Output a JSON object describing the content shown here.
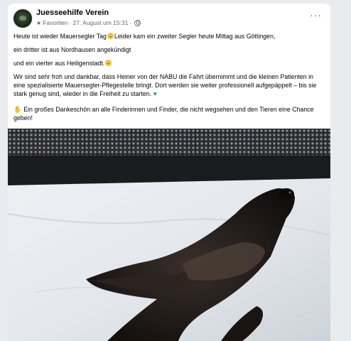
{
  "post": {
    "page_name": "Juesseehilfe Verein",
    "audience": "Favoriten",
    "separator": "·",
    "date": "27. August um 15:31",
    "more_label": "···",
    "paragraphs": [
      "Heute ist wieder Mauersegler Tag",
      "Leider kam ein zweiter Segler heute Mittag aus Göttingen,",
      "ein dritter ist aus Nordhausen angekündigt",
      "und ein vierter aus Heiligenstadt.",
      "Wir sind sehr froh und dankbar, dass Heiner von der  NABU die Fahrt übernimmt und die kleinen Patienten in eine spezialisierte Mauersegler-Pflegestelle bringt. Dort werden sie weiter professionell aufgepäppelt – bis sie stark genug sind, wieder in die Freiheit zu starten.",
      "Ein großes Dankeschön an alle Finderinnen und Finder, die nicht wegsehen und den Tieren eine Chance geben!"
    ],
    "icons": {
      "avatar": "organization-avatar",
      "audience": "star-icon",
      "privacy": "globe-icon",
      "sad": "sad-face-emoji",
      "heart": "green-heart-emoji",
      "pray": "folded-hands-emoji"
    }
  }
}
